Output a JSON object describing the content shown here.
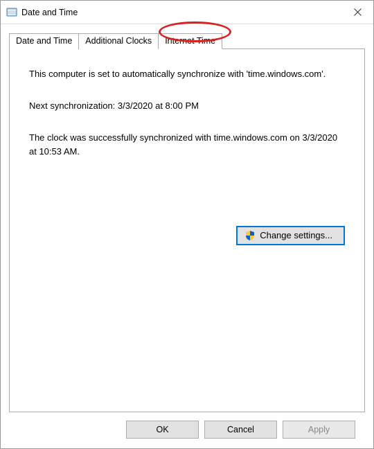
{
  "window": {
    "title": "Date and Time"
  },
  "tabs": [
    {
      "label": "Date and Time"
    },
    {
      "label": "Additional Clocks"
    },
    {
      "label": "Internet Time"
    }
  ],
  "content": {
    "sync_text": "This computer is set to automatically synchronize with 'time.windows.com'.",
    "next_sync": "Next synchronization: 3/3/2020 at 8:00 PM",
    "last_sync": "The clock was successfully synchronized with time.windows.com on 3/3/2020 at 10:53 AM.",
    "change_settings_label": "Change settings..."
  },
  "footer": {
    "ok": "OK",
    "cancel": "Cancel",
    "apply": "Apply"
  },
  "annotation": {
    "highlighted_tab_index": 2
  }
}
